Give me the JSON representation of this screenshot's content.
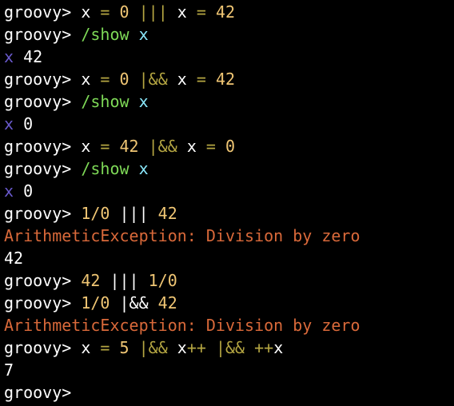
{
  "colors": {
    "background": "#000000",
    "prompt": "#ffffff",
    "plain": "#ffffff",
    "number": "#f0c674",
    "operator": "#b5a642",
    "command": "#7ed957",
    "variable": "#8be9fd",
    "var_output": "#6a5acd",
    "error": "#d9693a",
    "output": "#ffffff"
  },
  "terminal": {
    "lines": [
      [
        {
          "text": "groovy> ",
          "kind": "prompt"
        },
        {
          "text": "x ",
          "kind": "plain"
        },
        {
          "text": "= ",
          "kind": "operator"
        },
        {
          "text": "0 ",
          "kind": "number"
        },
        {
          "text": "||| ",
          "kind": "operator"
        },
        {
          "text": "x ",
          "kind": "plain"
        },
        {
          "text": "= ",
          "kind": "operator"
        },
        {
          "text": "42",
          "kind": "number"
        }
      ],
      [
        {
          "text": "groovy> ",
          "kind": "prompt"
        },
        {
          "text": "/show ",
          "kind": "command"
        },
        {
          "text": "x",
          "kind": "variable"
        }
      ],
      [
        {
          "text": "x ",
          "kind": "var_output"
        },
        {
          "text": "42",
          "kind": "output"
        }
      ],
      [
        {
          "text": "groovy> ",
          "kind": "prompt"
        },
        {
          "text": "x ",
          "kind": "plain"
        },
        {
          "text": "= ",
          "kind": "operator"
        },
        {
          "text": "0 ",
          "kind": "number"
        },
        {
          "text": "|&& ",
          "kind": "operator"
        },
        {
          "text": "x ",
          "kind": "plain"
        },
        {
          "text": "= ",
          "kind": "operator"
        },
        {
          "text": "42",
          "kind": "number"
        }
      ],
      [
        {
          "text": "groovy> ",
          "kind": "prompt"
        },
        {
          "text": "/show ",
          "kind": "command"
        },
        {
          "text": "x",
          "kind": "variable"
        }
      ],
      [
        {
          "text": "x ",
          "kind": "var_output"
        },
        {
          "text": "0",
          "kind": "output"
        }
      ],
      [
        {
          "text": "groovy> ",
          "kind": "prompt"
        },
        {
          "text": "x ",
          "kind": "plain"
        },
        {
          "text": "= ",
          "kind": "operator"
        },
        {
          "text": "42 ",
          "kind": "number"
        },
        {
          "text": "|&& ",
          "kind": "operator"
        },
        {
          "text": "x ",
          "kind": "plain"
        },
        {
          "text": "= ",
          "kind": "operator"
        },
        {
          "text": "0",
          "kind": "number"
        }
      ],
      [
        {
          "text": "groovy> ",
          "kind": "prompt"
        },
        {
          "text": "/show ",
          "kind": "command"
        },
        {
          "text": "x",
          "kind": "variable"
        }
      ],
      [
        {
          "text": "x ",
          "kind": "var_output"
        },
        {
          "text": "0",
          "kind": "output"
        }
      ],
      [
        {
          "text": "groovy> ",
          "kind": "prompt"
        },
        {
          "text": "1/0 ",
          "kind": "number"
        },
        {
          "text": "||| ",
          "kind": "plain"
        },
        {
          "text": "42",
          "kind": "number"
        }
      ],
      [
        {
          "text": "ArithmeticException: Division by zero",
          "kind": "error"
        }
      ],
      [
        {
          "text": "42",
          "kind": "output"
        }
      ],
      [
        {
          "text": "groovy> ",
          "kind": "prompt"
        },
        {
          "text": "42 ",
          "kind": "number"
        },
        {
          "text": "||| ",
          "kind": "plain"
        },
        {
          "text": "1/0",
          "kind": "number"
        }
      ],
      [
        {
          "text": "groovy> ",
          "kind": "prompt"
        },
        {
          "text": "1/0 ",
          "kind": "number"
        },
        {
          "text": "|&& ",
          "kind": "plain"
        },
        {
          "text": "42",
          "kind": "number"
        }
      ],
      [
        {
          "text": "ArithmeticException: Division by zero",
          "kind": "error"
        }
      ],
      [
        {
          "text": "groovy> ",
          "kind": "prompt"
        },
        {
          "text": "x ",
          "kind": "plain"
        },
        {
          "text": "= ",
          "kind": "operator"
        },
        {
          "text": "5 ",
          "kind": "number"
        },
        {
          "text": "|&& ",
          "kind": "operator"
        },
        {
          "text": "x",
          "kind": "plain"
        },
        {
          "text": "++ ",
          "kind": "operator"
        },
        {
          "text": "|&& ",
          "kind": "operator"
        },
        {
          "text": "++",
          "kind": "operator"
        },
        {
          "text": "x",
          "kind": "plain"
        }
      ],
      [
        {
          "text": "7",
          "kind": "output"
        }
      ],
      [
        {
          "text": "groovy>",
          "kind": "prompt"
        }
      ]
    ]
  }
}
